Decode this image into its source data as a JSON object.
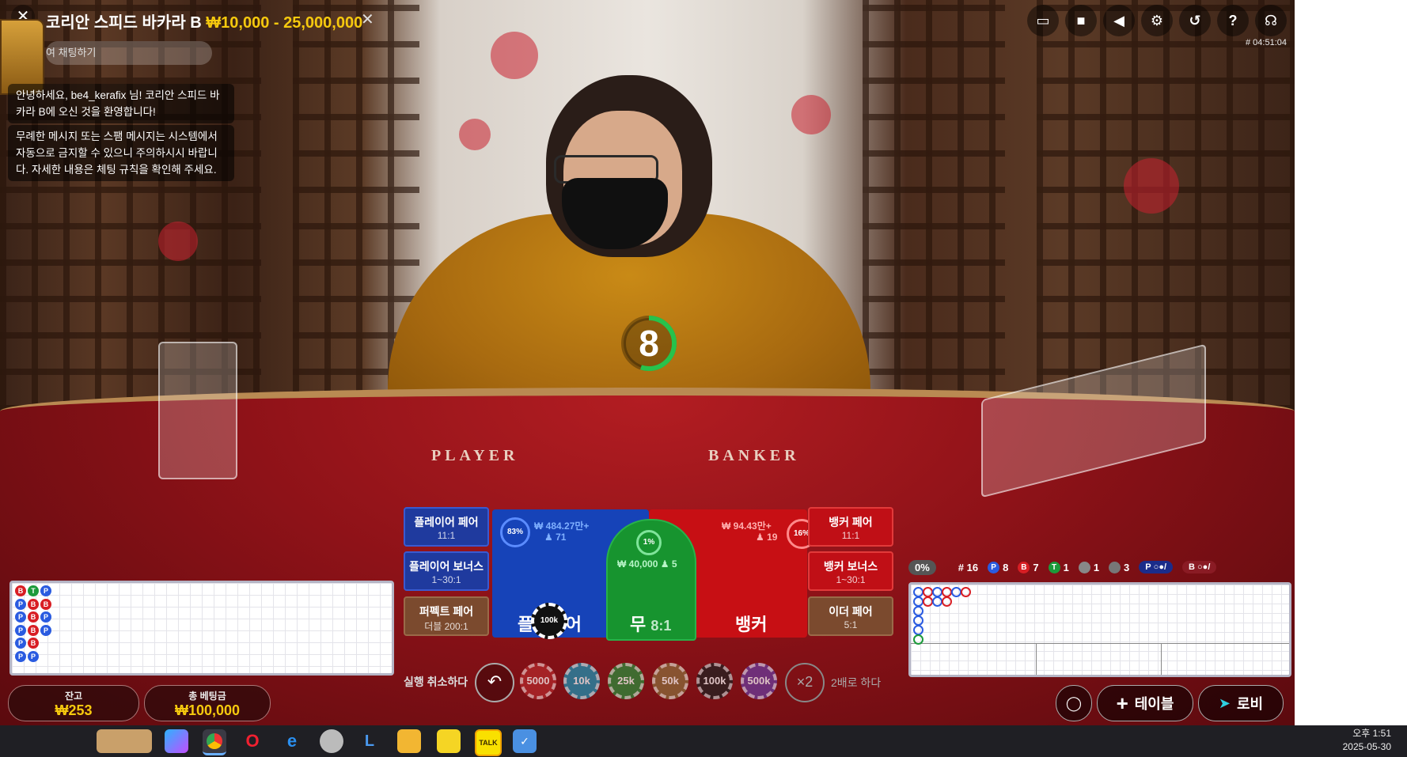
{
  "header": {
    "table_name": "코리안 스피드 바카라 B",
    "limit": "₩10,000 - 25,000,000",
    "round_id": "# 04:51:04"
  },
  "chat": {
    "placeholder": "여 채팅하기",
    "welcome": "안녕하세요, be4_kerafix 님! 코리안 스피드 바카라 B에 오신 것을 환영합니다!",
    "warning": "무례한 메시지 또는 스팸 메시지는 시스템에서 자동으로 금지할 수 있으니 주의하시시 바랍니다. 자세한 내용은 체팅 규칙을 확인해 주세요."
  },
  "top_icons": [
    "chat-icon",
    "video-icon",
    "volume-icon",
    "settings-icon",
    "history-icon",
    "help-icon",
    "headset-icon"
  ],
  "timer": {
    "value": "8",
    "fraction_remaining": 0.55
  },
  "table_text": {
    "player": "PLAYER",
    "banker": "BANKER"
  },
  "bets": {
    "player_pair": {
      "label": "플레이어 페어",
      "odds": "11:1"
    },
    "player_bonus": {
      "label": "플레이어 보너스",
      "odds": "1~30:1"
    },
    "perfect_pair": {
      "label": "퍼펙트 페어",
      "odds": "더블 200:1"
    },
    "banker_pair": {
      "label": "뱅커 페어",
      "odds": "11:1"
    },
    "banker_bonus": {
      "label": "뱅커 보너스",
      "odds": "1~30:1"
    },
    "either_pair": {
      "label": "이더 페어",
      "odds": "5:1"
    },
    "player": {
      "label": "플레이어",
      "total": "₩ 484.27만+",
      "players": "71",
      "pct": "83%"
    },
    "banker": {
      "label": "뱅커",
      "total": "₩ 94.43만+",
      "players": "19",
      "pct": "16%"
    },
    "tie": {
      "label": "무",
      "odds": "8:1",
      "total": "₩ 40,000",
      "players": "5",
      "pct": "1%"
    },
    "placed_chip": "100k"
  },
  "controls": {
    "undo_label": "실행 취소하다",
    "double_label": "2배로 하다",
    "double_symbol": "×2",
    "chips": [
      "5000",
      "10k",
      "25k",
      "50k",
      "100k",
      "500k"
    ]
  },
  "balance": {
    "label": "잔고",
    "value": "₩253"
  },
  "total_bet": {
    "label": "총 베팅금",
    "value": "₩100,000"
  },
  "road_stats": {
    "zero_pct": "0%",
    "round": "# 16",
    "player": "8",
    "banker": "7",
    "tie": "1",
    "player_pair": "1",
    "banker_pair": "3",
    "p_predict": "P",
    "b_predict": "B"
  },
  "bead_road": [
    [
      "B",
      "P",
      "P",
      "P",
      "P",
      "P"
    ],
    [
      "T",
      "B",
      "B",
      "B",
      "B",
      "P"
    ],
    [
      "P",
      "B",
      "P",
      "P",
      "",
      ""
    ]
  ],
  "nav": {
    "table_label": "테이블",
    "lobby_label": "로비"
  },
  "taskbar": {
    "apps": [
      "potato-app-icon",
      "copilot-icon",
      "chrome-icon",
      "opera-icon",
      "ie-icon",
      "game-icon",
      "app-icon",
      "folder-icon",
      "notes-icon",
      "kakaotalk-icon",
      "check-icon"
    ],
    "kakao_label": "TALK",
    "time": "오후 1:51",
    "date": "2025-05-30"
  },
  "colors": {
    "player": "#1643b8",
    "banker": "#c70f14",
    "tie": "#17942f",
    "gold": "#f6c90e"
  }
}
